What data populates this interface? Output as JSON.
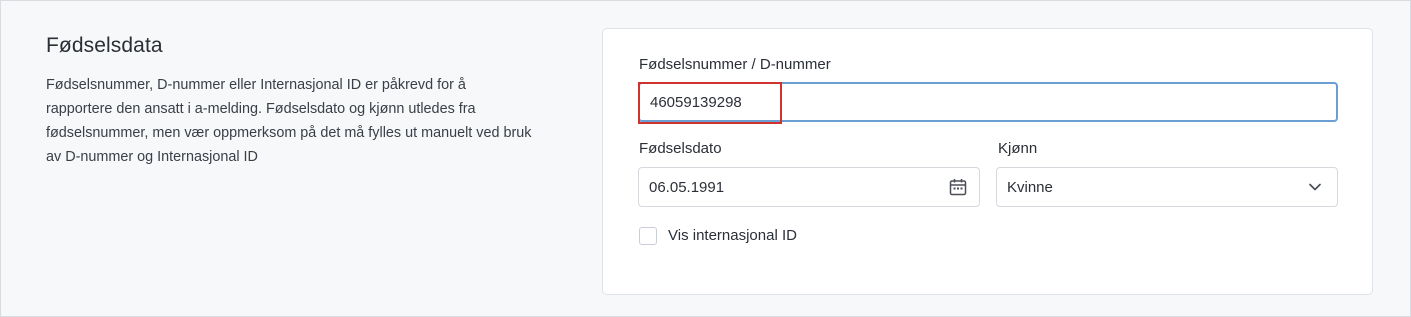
{
  "section": {
    "title": "Fødselsdata",
    "description": "Fødselsnummer, D-nummer eller Internasjonal ID er påkrevd for å rapportere den ansatt i a-melding. Fødselsdato og kjønn utledes fra fødselsnummer, men vær oppmerksom på det må fylles ut manuelt ved bruk av D-nummer og Internasjonal ID"
  },
  "form": {
    "id_label": "Fødselsnummer / D-nummer",
    "id_value": "46059139298",
    "birthdate_label": "Fødselsdato",
    "birthdate_value": "06.05.1991",
    "gender_label": "Kjønn",
    "gender_value": "Kvinne",
    "intl_id_checkbox_label": "Vis internasjonal ID",
    "intl_id_checked": false
  },
  "icons": {
    "calendar": "calendar-icon",
    "dropdown": "chevron-down-icon"
  },
  "colors": {
    "focus_border": "#6b9fd4",
    "highlight_border": "#d0332e"
  }
}
